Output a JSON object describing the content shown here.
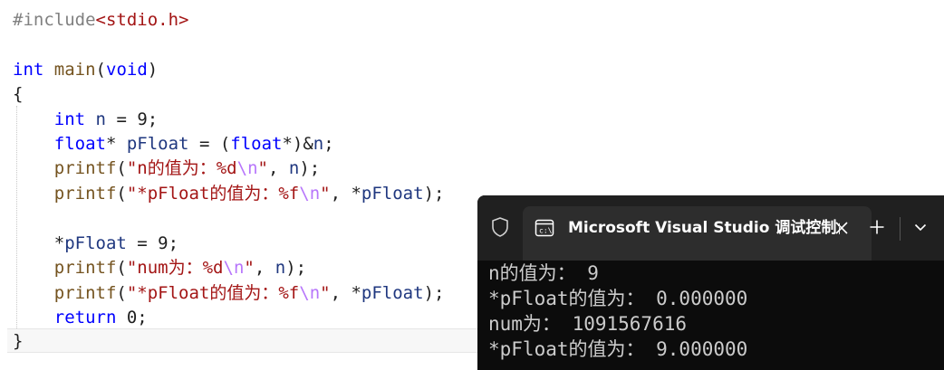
{
  "colors": {
    "keyword": "#0000ff",
    "preprocessor": "#808080",
    "include_path": "#a31515",
    "function": "#74531f",
    "string": "#a31515",
    "escape": "#b776fb",
    "variable": "#1f377f",
    "terminal_bg": "#0c0c0c",
    "terminal_tabbar": "#202020",
    "terminal_tab": "#2d2d2d",
    "terminal_text": "#cccccc"
  },
  "editor": {
    "lines": [
      {
        "tokens": [
          {
            "t": "pp",
            "s": "#include"
          },
          {
            "t": "inc",
            "s": "<stdio.h>"
          }
        ]
      },
      {
        "tokens": []
      },
      {
        "tokens": [
          {
            "t": "kw",
            "s": "int"
          },
          {
            "t": "plain",
            "s": " "
          },
          {
            "t": "fn",
            "s": "main"
          },
          {
            "t": "plain",
            "s": "("
          },
          {
            "t": "kw",
            "s": "void"
          },
          {
            "t": "plain",
            "s": ")"
          }
        ]
      },
      {
        "tokens": [
          {
            "t": "plain",
            "s": "{"
          }
        ]
      },
      {
        "tokens": [
          {
            "t": "plain",
            "s": "    "
          },
          {
            "t": "kw",
            "s": "int"
          },
          {
            "t": "plain",
            "s": " "
          },
          {
            "t": "var",
            "s": "n"
          },
          {
            "t": "plain",
            "s": " = 9;"
          }
        ]
      },
      {
        "tokens": [
          {
            "t": "plain",
            "s": "    "
          },
          {
            "t": "kw",
            "s": "float"
          },
          {
            "t": "plain",
            "s": "* "
          },
          {
            "t": "var",
            "s": "pFloat"
          },
          {
            "t": "plain",
            "s": " = ("
          },
          {
            "t": "kw",
            "s": "float"
          },
          {
            "t": "plain",
            "s": "*)&"
          },
          {
            "t": "var",
            "s": "n"
          },
          {
            "t": "plain",
            "s": ";"
          }
        ]
      },
      {
        "tokens": [
          {
            "t": "plain",
            "s": "    "
          },
          {
            "t": "fn",
            "s": "printf"
          },
          {
            "t": "plain",
            "s": "("
          },
          {
            "t": "str",
            "s": "\"n的值为：%d"
          },
          {
            "t": "esc",
            "s": "\\n"
          },
          {
            "t": "str",
            "s": "\""
          },
          {
            "t": "plain",
            "s": ", "
          },
          {
            "t": "var",
            "s": "n"
          },
          {
            "t": "plain",
            "s": ");"
          }
        ]
      },
      {
        "tokens": [
          {
            "t": "plain",
            "s": "    "
          },
          {
            "t": "fn",
            "s": "printf"
          },
          {
            "t": "plain",
            "s": "("
          },
          {
            "t": "str",
            "s": "\"*pFloat的值为：%f"
          },
          {
            "t": "esc",
            "s": "\\n"
          },
          {
            "t": "str",
            "s": "\""
          },
          {
            "t": "plain",
            "s": ", *"
          },
          {
            "t": "var",
            "s": "pFloat"
          },
          {
            "t": "plain",
            "s": ");"
          }
        ]
      },
      {
        "tokens": []
      },
      {
        "tokens": [
          {
            "t": "plain",
            "s": "    *"
          },
          {
            "t": "var",
            "s": "pFloat"
          },
          {
            "t": "plain",
            "s": " = 9;"
          }
        ]
      },
      {
        "tokens": [
          {
            "t": "plain",
            "s": "    "
          },
          {
            "t": "fn",
            "s": "printf"
          },
          {
            "t": "plain",
            "s": "("
          },
          {
            "t": "str",
            "s": "\"num为：%d"
          },
          {
            "t": "esc",
            "s": "\\n"
          },
          {
            "t": "str",
            "s": "\""
          },
          {
            "t": "plain",
            "s": ", "
          },
          {
            "t": "var",
            "s": "n"
          },
          {
            "t": "plain",
            "s": ");"
          }
        ]
      },
      {
        "tokens": [
          {
            "t": "plain",
            "s": "    "
          },
          {
            "t": "fn",
            "s": "printf"
          },
          {
            "t": "plain",
            "s": "("
          },
          {
            "t": "str",
            "s": "\"*pFloat的值为：%f"
          },
          {
            "t": "esc",
            "s": "\\n"
          },
          {
            "t": "str",
            "s": "\""
          },
          {
            "t": "plain",
            "s": ", *"
          },
          {
            "t": "var",
            "s": "pFloat"
          },
          {
            "t": "plain",
            "s": ");"
          }
        ]
      },
      {
        "tokens": [
          {
            "t": "plain",
            "s": "    "
          },
          {
            "t": "kw",
            "s": "return"
          },
          {
            "t": "plain",
            "s": " 0;"
          }
        ]
      },
      {
        "tokens": [
          {
            "t": "plain",
            "s": "}"
          }
        ]
      }
    ]
  },
  "terminal": {
    "tab_title": "Microsoft Visual Studio 调试控制台",
    "shield_icon": "shield-icon",
    "console_icon": "console-app-icon",
    "close_icon": "close-icon",
    "new_tab_icon": "plus-icon",
    "dropdown_icon": "chevron-down-icon",
    "output_lines": [
      "n的值为： 9",
      "*pFloat的值为： 0.000000",
      "num为： 1091567616",
      "*pFloat的值为： 9.000000"
    ]
  }
}
